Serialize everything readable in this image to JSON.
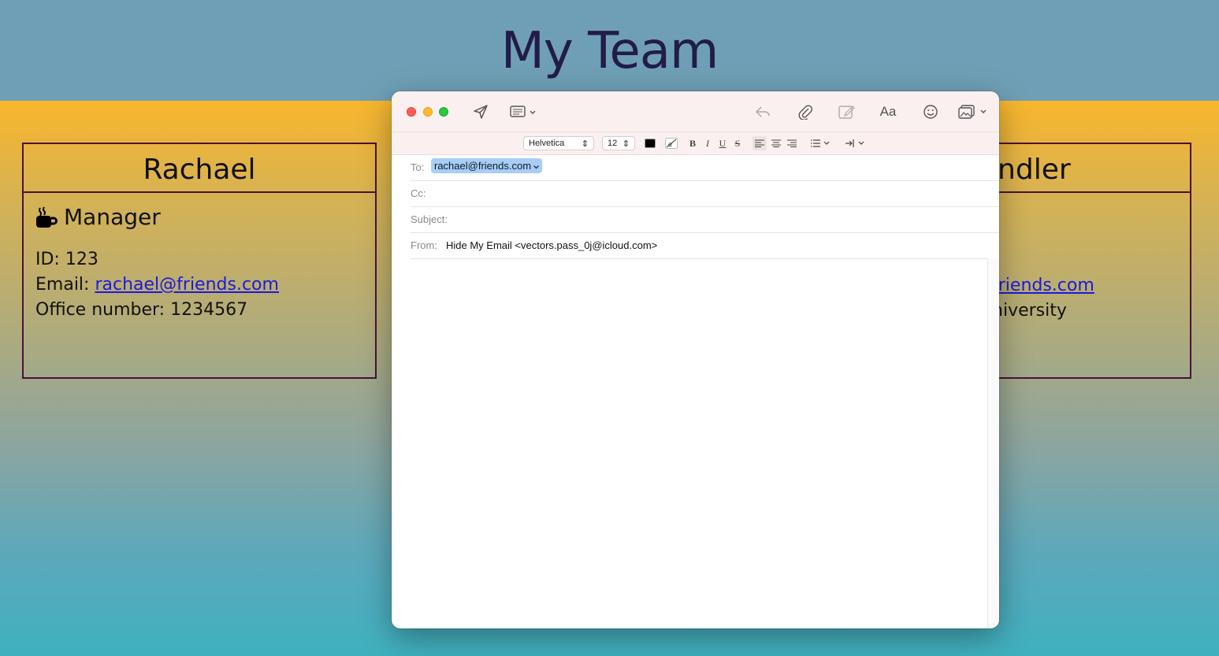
{
  "page": {
    "title": "My Team"
  },
  "cards": {
    "left": {
      "name": "Rachael",
      "role": "Manager",
      "role_icon": "coffee-mug-icon",
      "id_line": "ID: 123",
      "email_label": "Email: ",
      "email": "rachael@friends.com",
      "office_line": "Office number: 1234567"
    },
    "right": {
      "name_visible": "andler",
      "email_visible": "friends.com",
      "school_visible": "niversity"
    }
  },
  "mail": {
    "toolbar": {
      "send_icon": "paper-plane-icon",
      "header_icon": "header-fields-icon",
      "reply_icon": "reply-icon",
      "attach_icon": "paperclip-icon",
      "markup_icon": "markup-icon",
      "format_label": "Aa",
      "emoji_icon": "emoji-icon",
      "photo_icon": "photo-browser-icon"
    },
    "format": {
      "font": "Helvetica",
      "size": "12",
      "bold": "B",
      "italic": "I",
      "underline": "U",
      "strike": "S"
    },
    "fields": {
      "to_label": "To:",
      "to_value": "rachael@friends.com",
      "cc_label": "Cc:",
      "subject_label": "Subject:",
      "from_label": "From:",
      "from_value": "Hide My Email <vectors.pass_0j@icloud.com>"
    }
  },
  "colors": {
    "header_band": "#6f9fb6",
    "title": "#221c4a",
    "card_border": "#4a1238",
    "link": "#1a1ae0",
    "chip": "#a8cdf6"
  }
}
